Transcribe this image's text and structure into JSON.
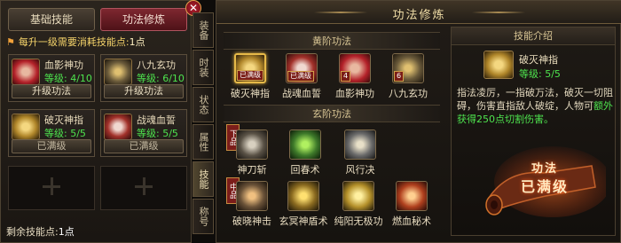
{
  "left": {
    "tabs": [
      "基础技能",
      "功法修炼"
    ],
    "notice": {
      "text": "每升一级需要消耗技能点:",
      "value": "1点"
    },
    "cards": [
      {
        "name": "血影神功",
        "level": "等级: 4/10",
        "button": "升级功法",
        "icon": "blood-shadow-icon",
        "color": "#b4222a"
      },
      {
        "name": "八九玄功",
        "level": "等级: 6/10",
        "button": "升级功法",
        "icon": "eighty-nine-icon",
        "color": "#6a5a3a"
      },
      {
        "name": "破灭神指",
        "level": "等级: 5/5",
        "button": "已满级",
        "icon": "finger-icon",
        "color": "#b0862a"
      },
      {
        "name": "战魂血誓",
        "level": "等级: 5/5",
        "button": "已满级",
        "icon": "war-soul-icon",
        "color": "#a2312a"
      }
    ],
    "remain": {
      "label": "剩余技能点:",
      "value": "1点"
    }
  },
  "side_tabs": [
    "装备",
    "时装",
    "状态",
    "属性",
    "技能",
    "称号"
  ],
  "active_side_tab": 4,
  "right": {
    "title": "功法修炼",
    "yellow": {
      "header": "黄阶功法",
      "skills": [
        {
          "name": "破灭神指",
          "badge": "已满级",
          "selected": true,
          "icon": "finger-icon",
          "color": "#b0862a"
        },
        {
          "name": "战魂血誓",
          "badge": "已满级",
          "icon": "war-soul-icon",
          "color": "#a2312a"
        },
        {
          "name": "血影神功",
          "badge": "4",
          "icon": "blood-shadow-icon",
          "color": "#b4222a"
        },
        {
          "name": "八九玄功",
          "badge": "6",
          "icon": "eighty-nine-icon",
          "color": "#6a5a3a"
        }
      ]
    },
    "mystic": {
      "header": "玄阶功法",
      "tier_low": "下品",
      "tier_mid": "中品",
      "row1": [
        {
          "name": "神刀斩",
          "icon": "blade-icon",
          "color": "#5a5246"
        },
        {
          "name": "回春术",
          "icon": "rejuvenate-icon",
          "color": "#3e7a2a"
        },
        {
          "name": "风行决",
          "icon": "wind-icon",
          "color": "#6a6a6a"
        }
      ],
      "row2": [
        {
          "name": "破晓神击",
          "icon": "dawn-strike-icon",
          "color": "#6a5238"
        },
        {
          "name": "玄冥神盾术",
          "icon": "shield-icon",
          "color": "#8a6a20"
        },
        {
          "name": "纯阳无极功",
          "icon": "yang-icon",
          "color": "#b4902a"
        },
        {
          "name": "燃血秘术",
          "icon": "burning-blood-icon",
          "color": "#b0401e"
        }
      ]
    },
    "info": {
      "header": "技能介绍",
      "name": "破灭神指",
      "level": "等级: 5/5",
      "desc_plain": "指法凌厉，一指破万法，破灭一切阻碍，伤害直指敌人破绽，人物可",
      "desc_green": "额外获得250点切割伤害。",
      "seal_line1": "功法",
      "seal_line2": "已满级",
      "icon": "finger-icon",
      "color": "#b0862a"
    }
  },
  "colors": {
    "gold": "#e6b948",
    "green": "#4ee44e",
    "red": "#7b1d1a"
  }
}
